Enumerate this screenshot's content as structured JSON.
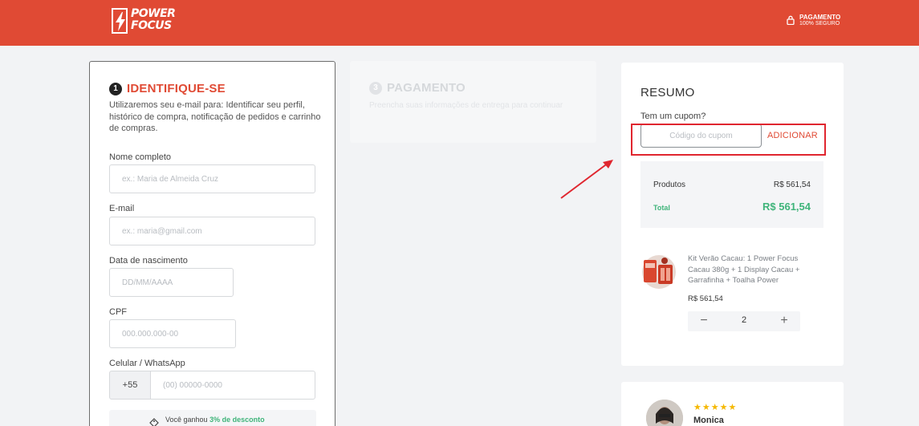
{
  "header": {
    "logo_line1": "POWER",
    "logo_line2": "FOCUS",
    "secure_line1": "PAGAMENTO",
    "secure_line2": "100% SEGURO",
    "brand_color": "#e04a34"
  },
  "identify": {
    "step_number": "1",
    "title": "IDENTIFIQUE-SE",
    "description": "Utilizaremos seu e-mail para: Identificar seu perfil, histórico de compra, notificação de pedidos e carrinho de compras.",
    "fields": {
      "name_label": "Nome completo",
      "name_placeholder": "ex.: Maria de Almeida Cruz",
      "email_label": "E-mail",
      "email_placeholder": "ex.: maria@gmail.com",
      "birth_label": "Data de nascimento",
      "birth_placeholder": "DD/MM/AAAA",
      "cpf_label": "CPF",
      "cpf_placeholder": "000.000.000-00",
      "phone_label": "Celular / WhatsApp",
      "phone_prefix": "+55",
      "phone_placeholder": "(00) 00000-0000"
    },
    "discount_prefix": "Você ganhou",
    "discount_highlight": "3% de desconto"
  },
  "payment": {
    "step_number": "3",
    "title": "PAGAMENTO",
    "description": "Preencha suas informações de entrega para continuar"
  },
  "summary": {
    "title": "RESUMO",
    "coupon_question": "Tem um cupom?",
    "coupon_placeholder": "Código do cupom",
    "coupon_button": "ADICIONAR",
    "products_label": "Produtos",
    "products_value": "R$ 561,54",
    "total_label": "Total",
    "total_value": "R$ 561,54",
    "total_color": "#3fb47a",
    "item": {
      "name": "Kit Verão Cacau: 1 Power Focus Cacau 380g + 1 Display Cacau + Garrafinha + Toalha Power",
      "price": "R$ 561,54",
      "quantity": "2"
    }
  },
  "review": {
    "stars": "★★★★★",
    "name": "Monica"
  }
}
